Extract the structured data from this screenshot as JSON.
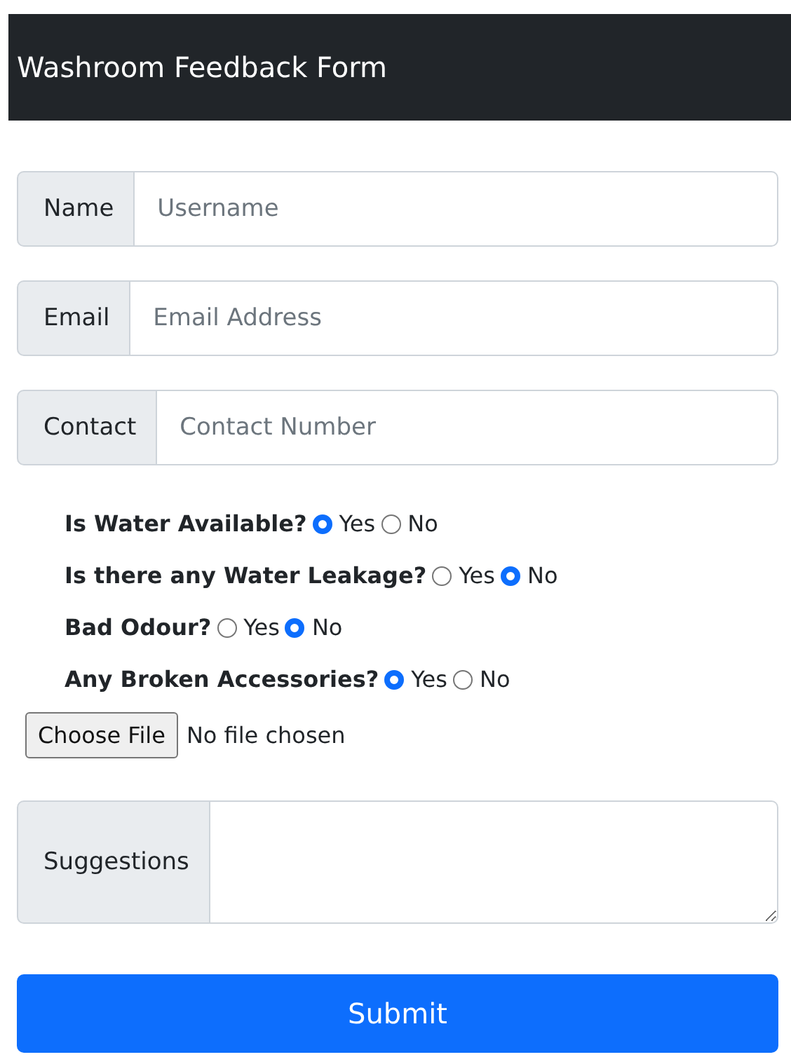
{
  "header": {
    "title": "Washroom Feedback Form"
  },
  "fields": [
    {
      "label": "Name",
      "placeholder": "Username"
    },
    {
      "label": "Email",
      "placeholder": "Email Address"
    },
    {
      "label": "Contact",
      "placeholder": "Contact Number"
    }
  ],
  "questions": [
    {
      "label": "Is Water Available?",
      "options": [
        {
          "label": "Yes",
          "selected": true
        },
        {
          "label": "No",
          "selected": false
        }
      ]
    },
    {
      "label": "Is there any Water Leakage?",
      "options": [
        {
          "label": "Yes",
          "selected": false
        },
        {
          "label": "No",
          "selected": true
        }
      ]
    },
    {
      "label": "Bad Odour?",
      "options": [
        {
          "label": "Yes",
          "selected": false
        },
        {
          "label": "No",
          "selected": true
        }
      ]
    },
    {
      "label": "Any Broken Accessories?",
      "options": [
        {
          "label": "Yes",
          "selected": true
        },
        {
          "label": "No",
          "selected": false
        }
      ]
    }
  ],
  "file_input": {
    "button": "Choose File",
    "status": "No file chosen"
  },
  "suggestions": {
    "label": "Suggestions"
  },
  "submit": "Submit"
}
